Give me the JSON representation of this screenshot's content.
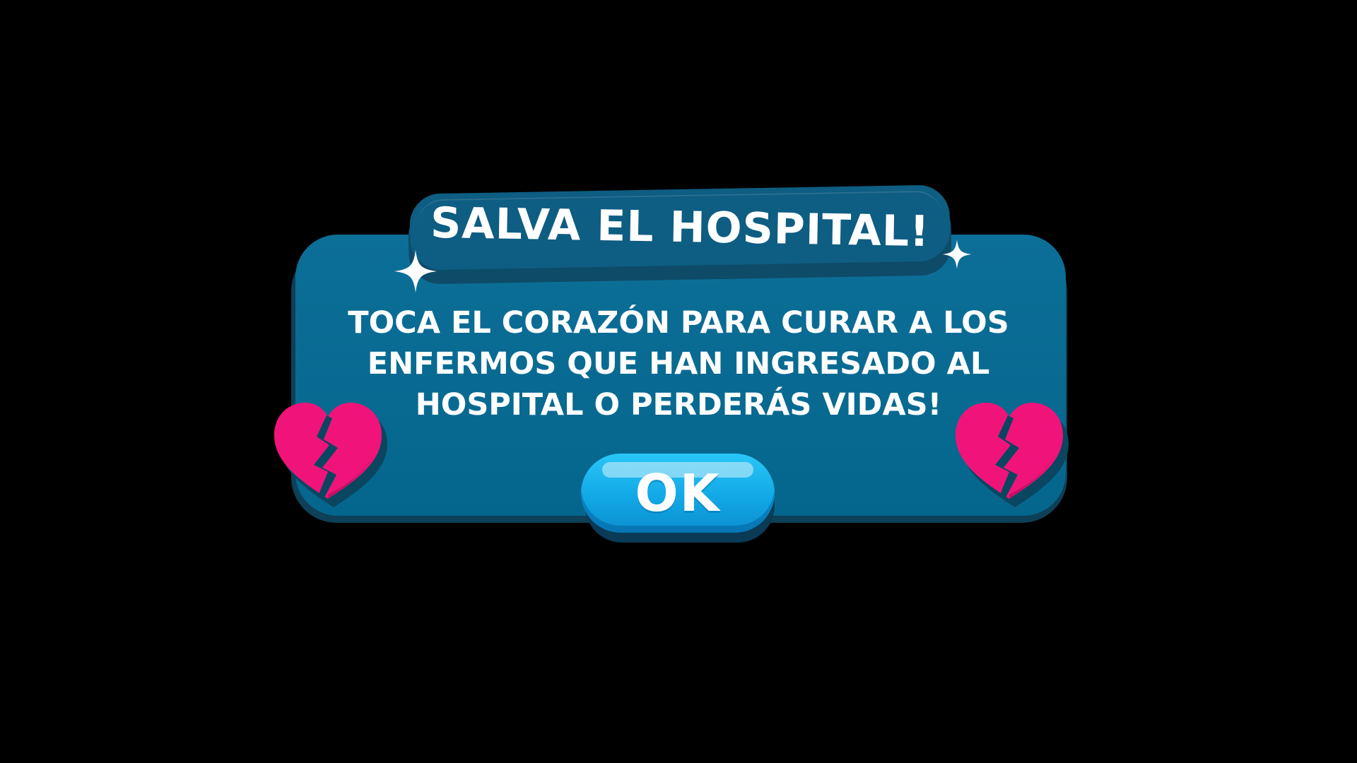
{
  "dialog": {
    "title": "SALVA EL HOSPITAL!",
    "message_lines": [
      "TOCA EL CORAZÓN PARA CURAR A LOS",
      "ENFERMOS QUE HAN INGRESADO AL",
      "HOSPITAL O PERDERÁS VIDAS!"
    ],
    "ok_label": "OK"
  },
  "icons": {
    "left_heart": "broken-heart-icon",
    "right_heart": "broken-heart-icon",
    "left_sparkle": "sparkle-icon",
    "right_sparkle": "sparkle-icon"
  },
  "colors": {
    "panel": "#05668d",
    "title_banner": "#0e5d82",
    "ok_button": "#12a8e6",
    "heart": "#f0147a",
    "text": "#ffffff"
  }
}
